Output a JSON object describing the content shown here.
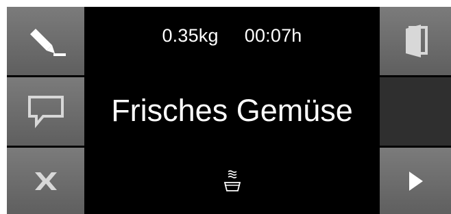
{
  "status": {
    "weight": "0.35kg",
    "time": "00:07h"
  },
  "program": {
    "name": "Frisches Gemüse"
  },
  "icons": {
    "edit": "pencil-icon",
    "comment": "speech-bubble-icon",
    "cancel": "close-icon",
    "door": "door-icon",
    "start": "play-icon",
    "mode": "steam-bowl-icon"
  },
  "colors": {
    "screen_bg": "#000000",
    "button_bg": "#6e6e6e",
    "button_disabled": "#2f2f2f",
    "icon_fill": "#ffffff",
    "icon_muted": "#cfcfcf",
    "text": "#ffffff"
  }
}
